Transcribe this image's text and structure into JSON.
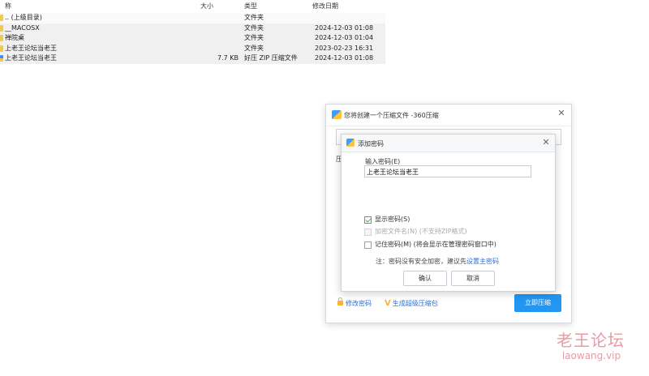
{
  "file_list": {
    "headers": {
      "name": "称",
      "size": "大小",
      "type": "类型",
      "date": "修改日期"
    },
    "rows": [
      {
        "name": ".. (上级目录)",
        "size": "",
        "type": "文件夹",
        "date": ""
      },
      {
        "name": "__MACOSX",
        "size": "",
        "type": "文件夹",
        "date": "2024-12-03 01:08"
      },
      {
        "name": "禅院桌",
        "size": "",
        "type": "文件夹",
        "date": "2024-12-03 01:04"
      },
      {
        "name": "上老王论坛当老王",
        "size": "",
        "type": "文件夹",
        "date": "2023-02-23 16:31"
      },
      {
        "name": "上老王论坛当老王",
        "size": "7.7 KB",
        "type": "好压 ZIP 压缩文件",
        "date": "2024-12-03 01:08"
      }
    ]
  },
  "outer_dialog": {
    "title": "您将创建一个压缩文件 -360压缩",
    "label_stub": "压",
    "edit_password_link": "修改密码",
    "super_zip_link": "生成超级压缩包",
    "compress_button": "立即压缩",
    "close_glyph": "✕"
  },
  "inner_dialog": {
    "title": "添加密码",
    "close_glyph": "✕",
    "password_label": "输入密码(E)",
    "password_value": "上老王论坛当老王",
    "show_password": {
      "label": "显示密码(S)",
      "checked": true
    },
    "encrypt_filename": {
      "label": "加密文件名(N) (不支持ZIP格式)",
      "checked": false,
      "disabled": true
    },
    "remember_password": {
      "label": "记住密码(M) (将会显示在管理密码窗口中)",
      "checked": false
    },
    "note_prefix": "注：密码没有安全加密，建议先",
    "note_link": "设置主密码",
    "ok_button": "确认",
    "cancel_button": "取消"
  },
  "watermark": {
    "text": "老王论坛",
    "url": "laowang.vip"
  },
  "colors": {
    "accent": "#2196f3",
    "link": "#2d6fd6",
    "check": "#4caf50",
    "watermark": "#e89ba2"
  }
}
